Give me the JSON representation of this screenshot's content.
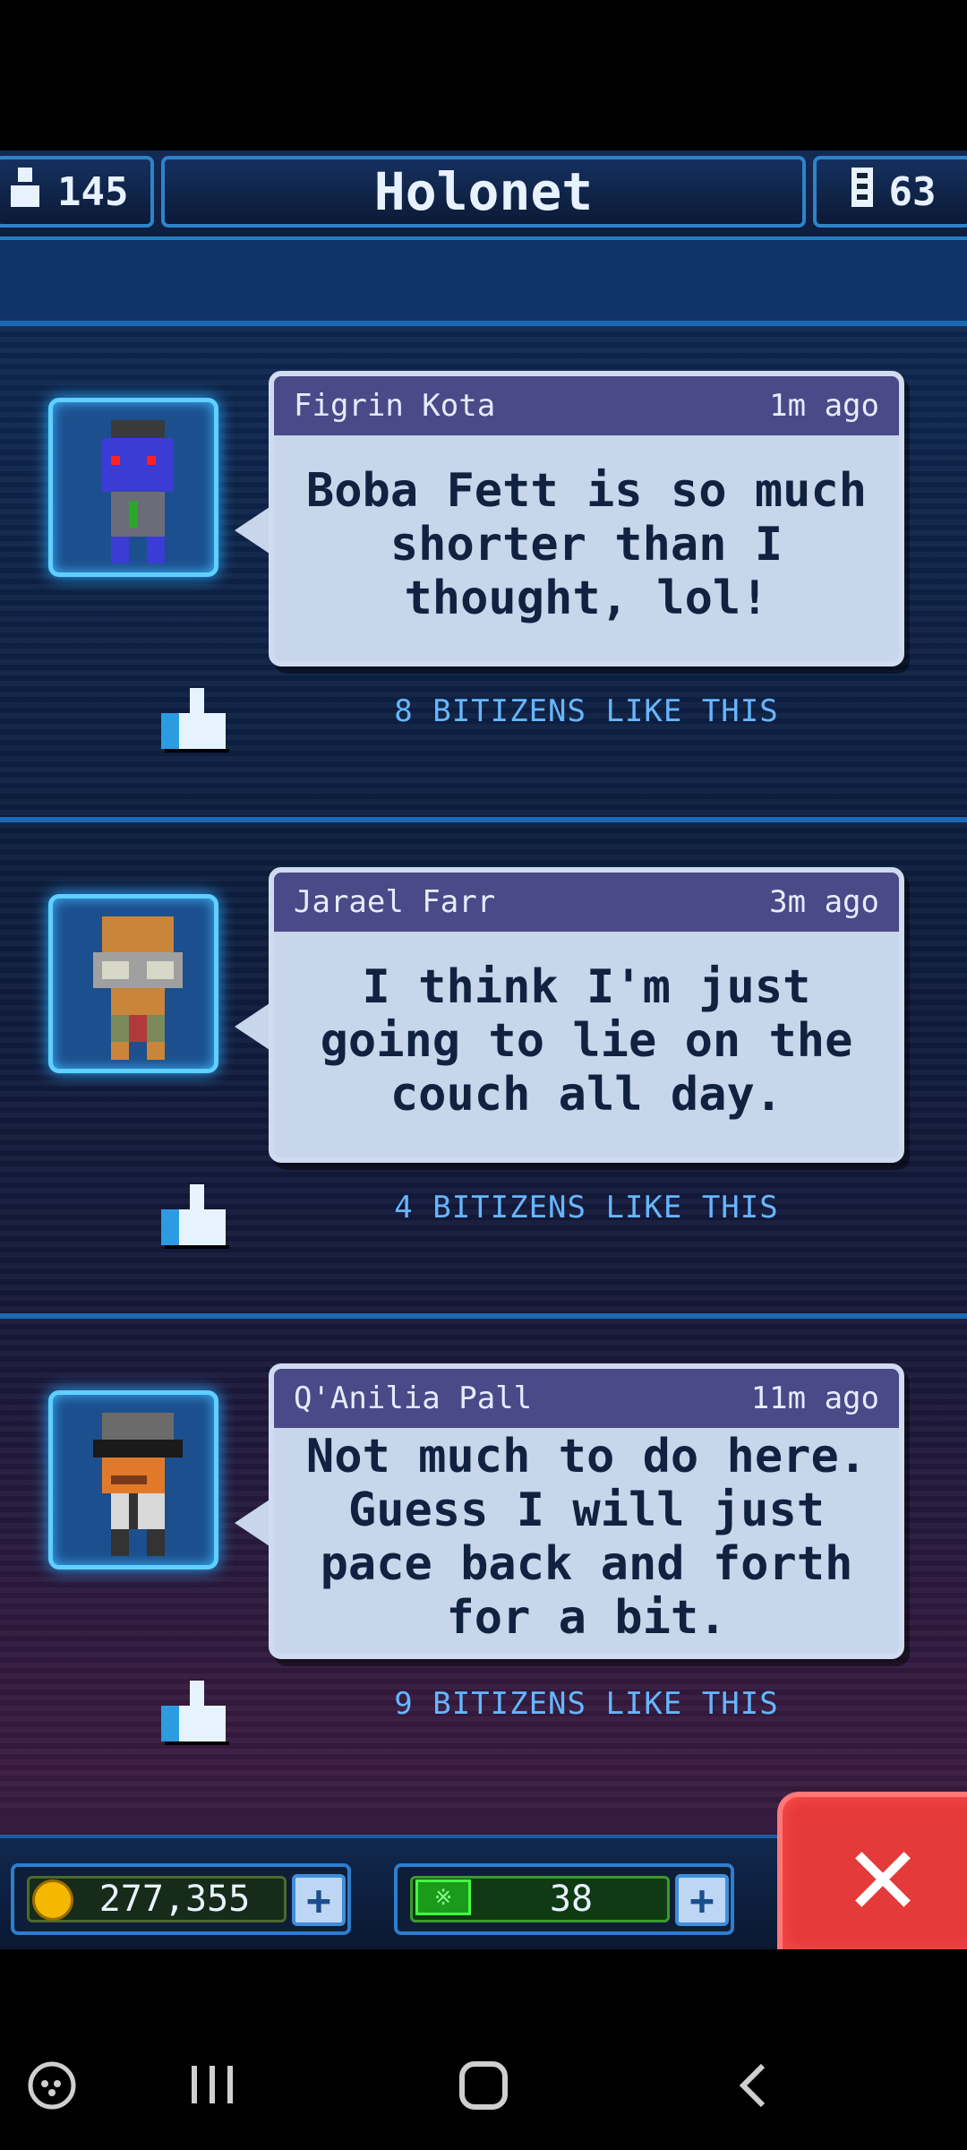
{
  "header": {
    "population": "145",
    "title": "Holonet",
    "floors": "63"
  },
  "posts": [
    {
      "author": "Figrin Kota",
      "time": "1m ago",
      "message": "Boba Fett is so much shorter than I thought, lol!",
      "likes": "8 BITIZENS LIKE THIS"
    },
    {
      "author": "Jarael Farr",
      "time": "3m ago",
      "message": "I think I'm just going to lie on the couch all day.",
      "likes": "4 BITIZENS LIKE THIS"
    },
    {
      "author": "Q'Anilia Pall",
      "time": "11m ago",
      "message": "Not much to do here. Guess I will just pace back and forth for a bit.",
      "likes": "9 BITIZENS LIKE THIS"
    }
  ],
  "currency": {
    "coins": "277,355",
    "bux": "38"
  },
  "colors": {
    "accent": "#2f83c9",
    "bubble": "#c7d6ea",
    "bubble_header": "#4a4a88",
    "likes_text": "#66b6ff",
    "close_red": "#e53a3a"
  }
}
